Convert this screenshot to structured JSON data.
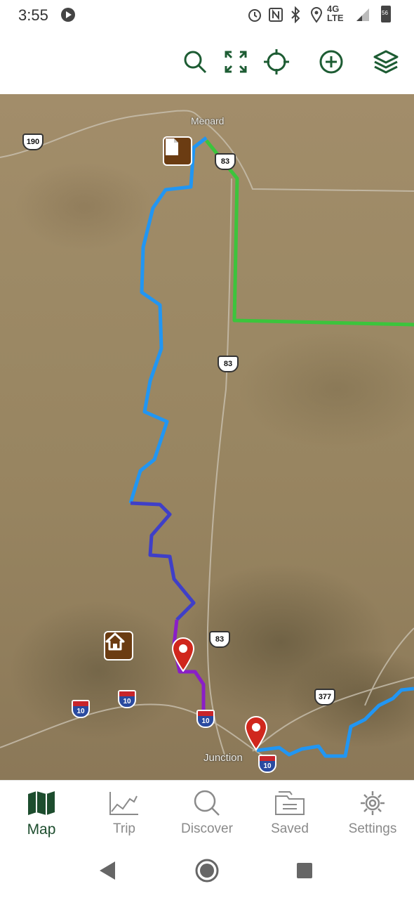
{
  "status_bar": {
    "time": "3:55",
    "network": "4G LTE",
    "battery": "56"
  },
  "toolbar": {
    "icons": [
      "search-icon",
      "fullscreen-icon",
      "locate-icon",
      "add-icon",
      "layers-icon"
    ],
    "accent_color": "#1d5c33"
  },
  "map": {
    "towns": {
      "menard": "Menard",
      "junction": "Junction"
    },
    "shields": {
      "us190": "190",
      "us83_top": "83",
      "us83_mid": "83",
      "us83_low": "83",
      "us377": "377"
    },
    "interstates": {
      "i10_a": "10",
      "i10_b": "10",
      "i10_c": "10",
      "i10_d": "10"
    },
    "route_colors": {
      "blue": "#2196f3",
      "indigo": "#3f3fc8",
      "purple": "#8a1ec8",
      "green": "#3cc43c"
    },
    "pin_color": "#d0271d"
  },
  "tabs": [
    {
      "label": "Map",
      "icon": "map-icon"
    },
    {
      "label": "Trip",
      "icon": "chart-icon"
    },
    {
      "label": "Discover",
      "icon": "search-icon"
    },
    {
      "label": "Saved",
      "icon": "folder-icon"
    },
    {
      "label": "Settings",
      "icon": "gear-icon"
    }
  ]
}
